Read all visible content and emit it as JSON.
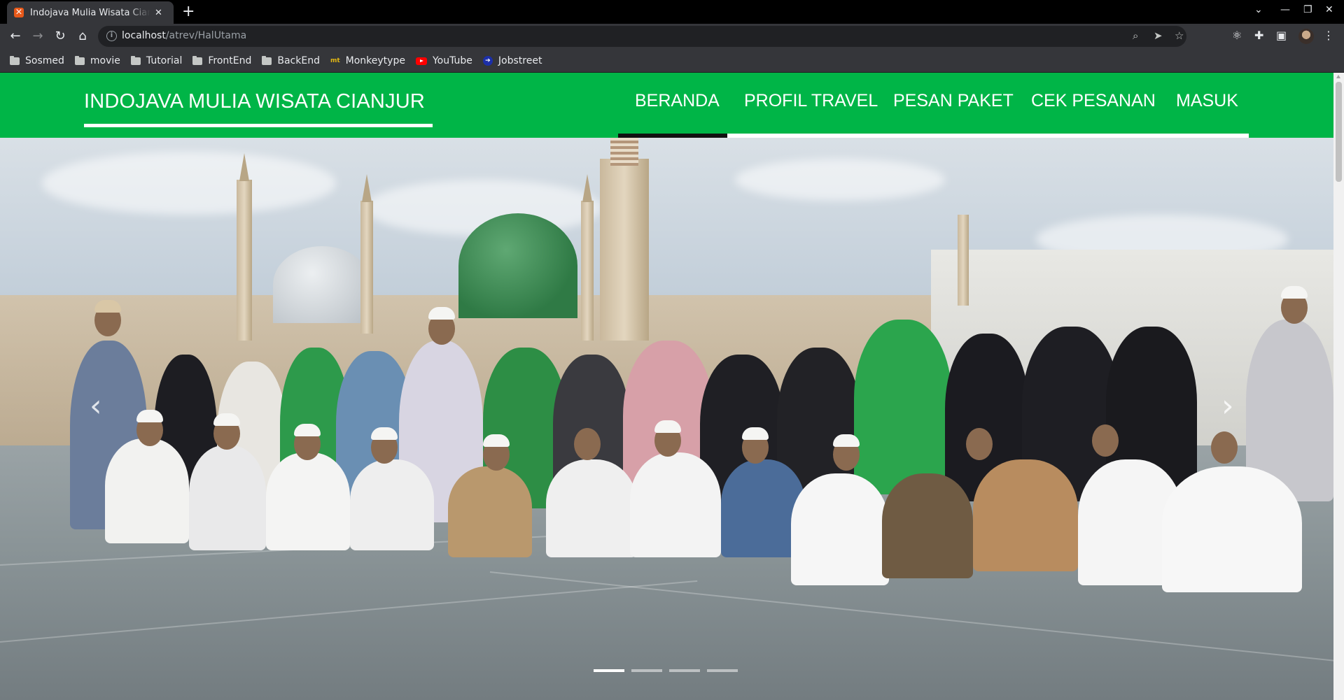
{
  "browser": {
    "tab": {
      "title": "Indojava Mulia Wisata Cianjur",
      "favicon": "xampp-icon"
    },
    "address": {
      "host": "localhost",
      "path": "/atrev/HalUtama"
    },
    "bookmarks": [
      {
        "label": "Sosmed",
        "icon": "folder-icon"
      },
      {
        "label": "movie",
        "icon": "folder-icon"
      },
      {
        "label": "Tutorial",
        "icon": "folder-icon"
      },
      {
        "label": "FrontEnd",
        "icon": "folder-icon"
      },
      {
        "label": "BackEnd",
        "icon": "folder-icon"
      },
      {
        "label": "Monkeytype",
        "icon": "monkeytype-icon"
      },
      {
        "label": "YouTube",
        "icon": "youtube-icon"
      },
      {
        "label": "Jobstreet",
        "icon": "jobstreet-icon"
      }
    ]
  },
  "site": {
    "brand": "INDOJAVA MULIA WISATA CIANJUR",
    "menu": [
      {
        "label": "BERANDA",
        "active": true
      },
      {
        "label": "PROFIL TRAVEL",
        "active": false
      },
      {
        "label": "PESAN PAKET",
        "active": false
      },
      {
        "label": "CEK PESANAN",
        "active": false
      },
      {
        "label": "MASUK",
        "active": false
      }
    ],
    "accent_color": "#00b547"
  },
  "carousel": {
    "slide_count": 4,
    "active_index": 0,
    "image_subject": "umrah pilgrim group photo in front of green dome mosque"
  }
}
